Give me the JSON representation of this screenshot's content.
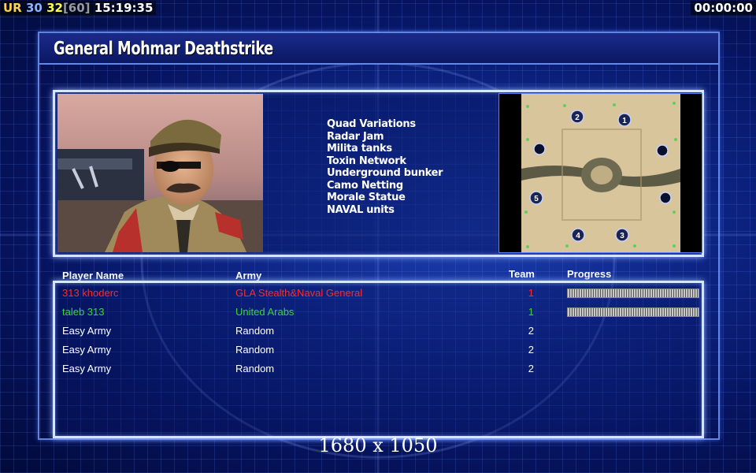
{
  "hud": {
    "ur_label": "UR",
    "fps": "30",
    "fps_cap": "32",
    "fps_max": "[60]",
    "clock": "15:19:35",
    "timer": "00:00:00"
  },
  "general": {
    "title": "General Mohmar Deathstrike",
    "features": [
      "Quad Variations",
      "Radar Jam",
      "Milita tanks",
      "Toxin Network",
      "Underground bunker",
      "Camo Netting",
      "Morale Statue",
      "NAVAL units"
    ]
  },
  "map": {
    "markers": [
      "2",
      "1",
      "5",
      "4",
      "3"
    ]
  },
  "table": {
    "headers": {
      "player": "Player Name",
      "army": "Army",
      "team": "Team",
      "progress": "Progress"
    },
    "rows": [
      {
        "name": "313 khoderc",
        "army": "GLA Stealth&Naval General",
        "team": "1",
        "color": "#ff2a2a",
        "progress": 1.0
      },
      {
        "name": "taleb 313",
        "army": "United Arabs",
        "team": "1",
        "color": "#39d639",
        "progress": 1.0
      },
      {
        "name": "Easy Army",
        "army": "Random",
        "team": "2",
        "color": "#ffffff"
      },
      {
        "name": "Easy Army",
        "army": "Random",
        "team": "2",
        "color": "#ffffff"
      },
      {
        "name": "Easy Army",
        "army": "Random",
        "team": "2",
        "color": "#ffffff"
      }
    ]
  },
  "footer": {
    "resolution": "1680 x 1050"
  },
  "colors": {
    "panel_border": "#d6e6ff",
    "background": "#0d2585",
    "hud_ur": "#ffd34a",
    "hud_fps": "#8ab4ff",
    "hud_cap": "#ffff40"
  }
}
